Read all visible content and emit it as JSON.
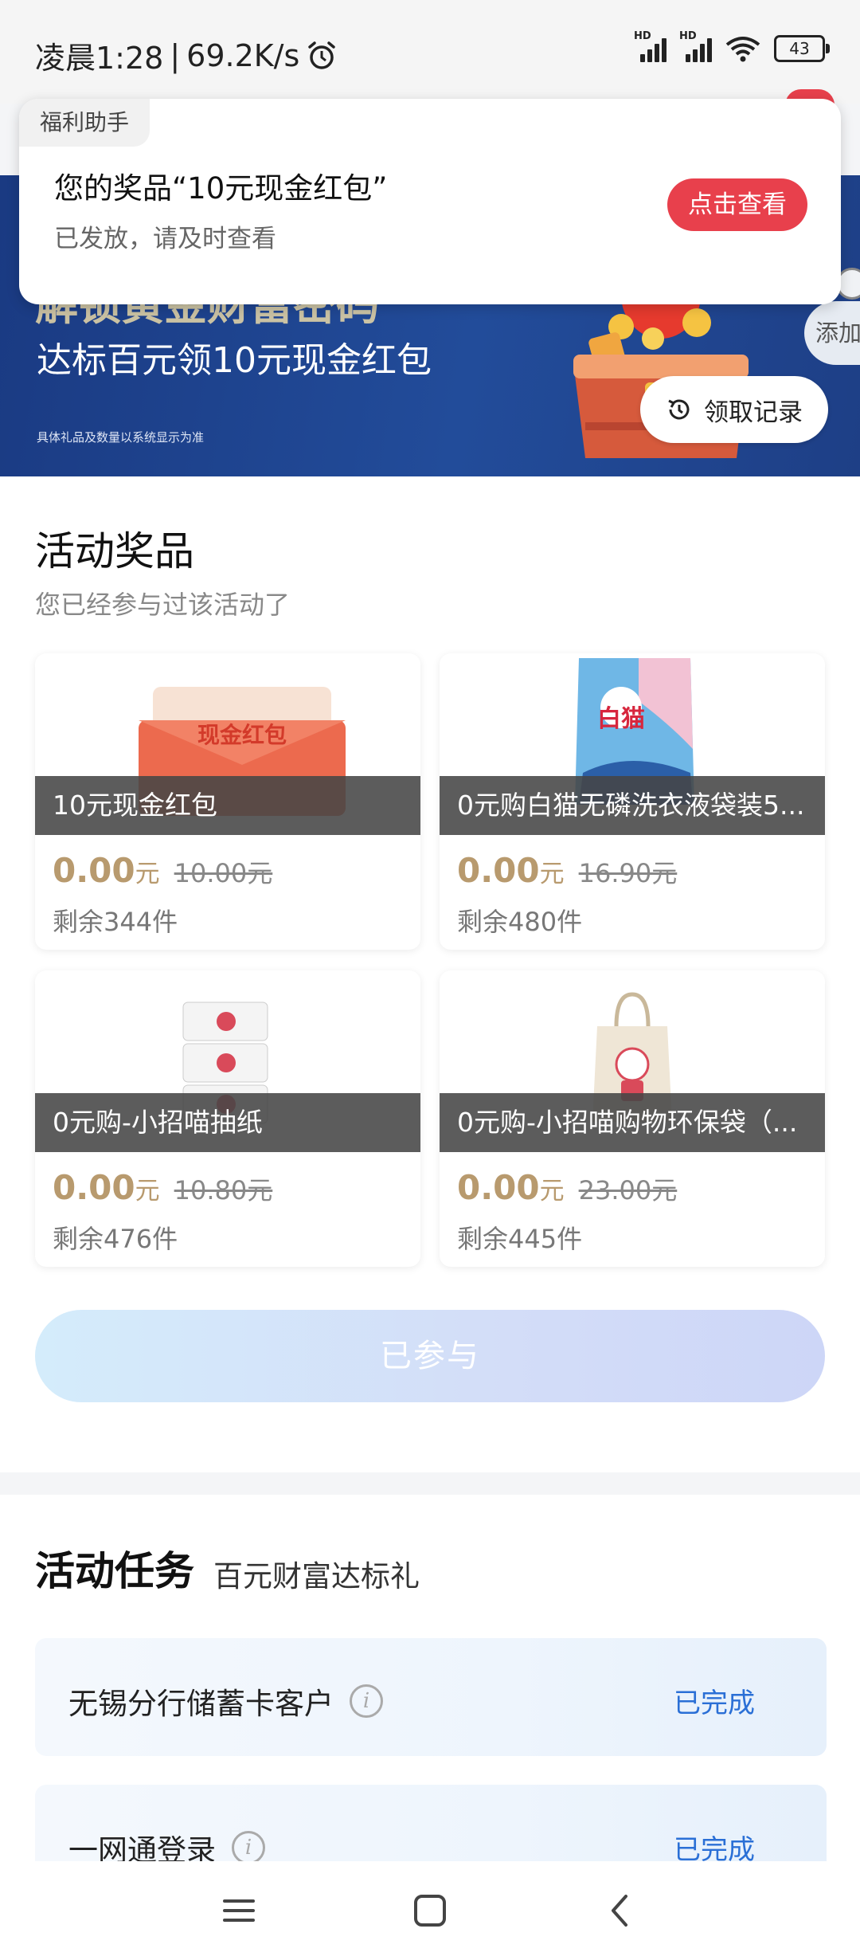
{
  "status_bar": {
    "time": "凌晨1:28",
    "separator": "|",
    "speed": "69.2K/s",
    "sim1_label": "HD",
    "sim2_label": "HD",
    "battery": "43"
  },
  "notification": {
    "source": "福利助手",
    "title": "您的奖品“10元现金红包”",
    "description": "已发放，请及时查看",
    "action_label": "点击查看"
  },
  "banner": {
    "heading": "解锁黄金财富密码",
    "subheading": "达标百元领10元现金红包",
    "note": "具体礼品及数量以系统显示为准",
    "record_button": "领取记录",
    "add_button": "添加"
  },
  "prizes": {
    "title": "活动奖品",
    "subtitle": "您已经参与过该活动了",
    "currency_suffix": "元",
    "items": [
      {
        "image_text": "现金红包",
        "name": "10元现金红包",
        "price": "0.00",
        "original": "10.00元",
        "remaining": "剩余344件"
      },
      {
        "image_text": "白猫",
        "name": "0元购白猫无磷洗衣液袋装5...",
        "price": "0.00",
        "original": "16.90元",
        "remaining": "剩余480件"
      },
      {
        "image_text": "",
        "name": "0元购-小招喵抽纸",
        "price": "0.00",
        "original": "10.80元",
        "remaining": "剩余476件"
      },
      {
        "image_text": "",
        "name": "0元购-小招喵购物环保袋（...",
        "price": "0.00",
        "original": "23.00元",
        "remaining": "剩余445件"
      }
    ],
    "joined_button": "已参与"
  },
  "tasks": {
    "title": "活动任务",
    "subtitle": "百元财富达标礼",
    "items": [
      {
        "name": "无锡分行储蓄卡客户",
        "status": "已完成"
      },
      {
        "name": "一网通登录",
        "status": "已完成"
      }
    ]
  },
  "colors": {
    "accent_red": "#e8404c",
    "price_gold": "#b89a6e",
    "status_blue": "#2a6fd6",
    "banner_blue": "#1a3a82"
  }
}
